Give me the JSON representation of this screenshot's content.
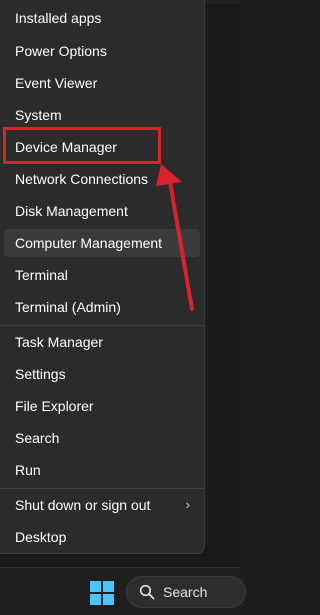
{
  "menu": {
    "items": [
      {
        "label": "Installed apps"
      },
      {
        "label": "Power Options"
      },
      {
        "label": "Event Viewer"
      },
      {
        "label": "System"
      },
      {
        "label": "Device Manager"
      },
      {
        "label": "Network Connections"
      },
      {
        "label": "Disk Management"
      },
      {
        "label": "Computer Management"
      },
      {
        "label": "Terminal"
      },
      {
        "label": "Terminal (Admin)"
      },
      {
        "label": "Task Manager"
      },
      {
        "label": "Settings"
      },
      {
        "label": "File Explorer"
      },
      {
        "label": "Search"
      },
      {
        "label": "Run"
      },
      {
        "label": "Shut down or sign out"
      },
      {
        "label": "Desktop"
      }
    ],
    "hovered_item": "Computer Management",
    "highlighted_item": "Device Manager",
    "submenu_chevron": "›"
  },
  "taskbar": {
    "start_icon": "windows-logo-icon",
    "search_label": "Search"
  },
  "colors": {
    "menu_bg": "#2b2b2b",
    "hover_bg": "#3a3a3a",
    "annotation_red": "#d9232b",
    "start_blue": "#4cc2ff"
  }
}
